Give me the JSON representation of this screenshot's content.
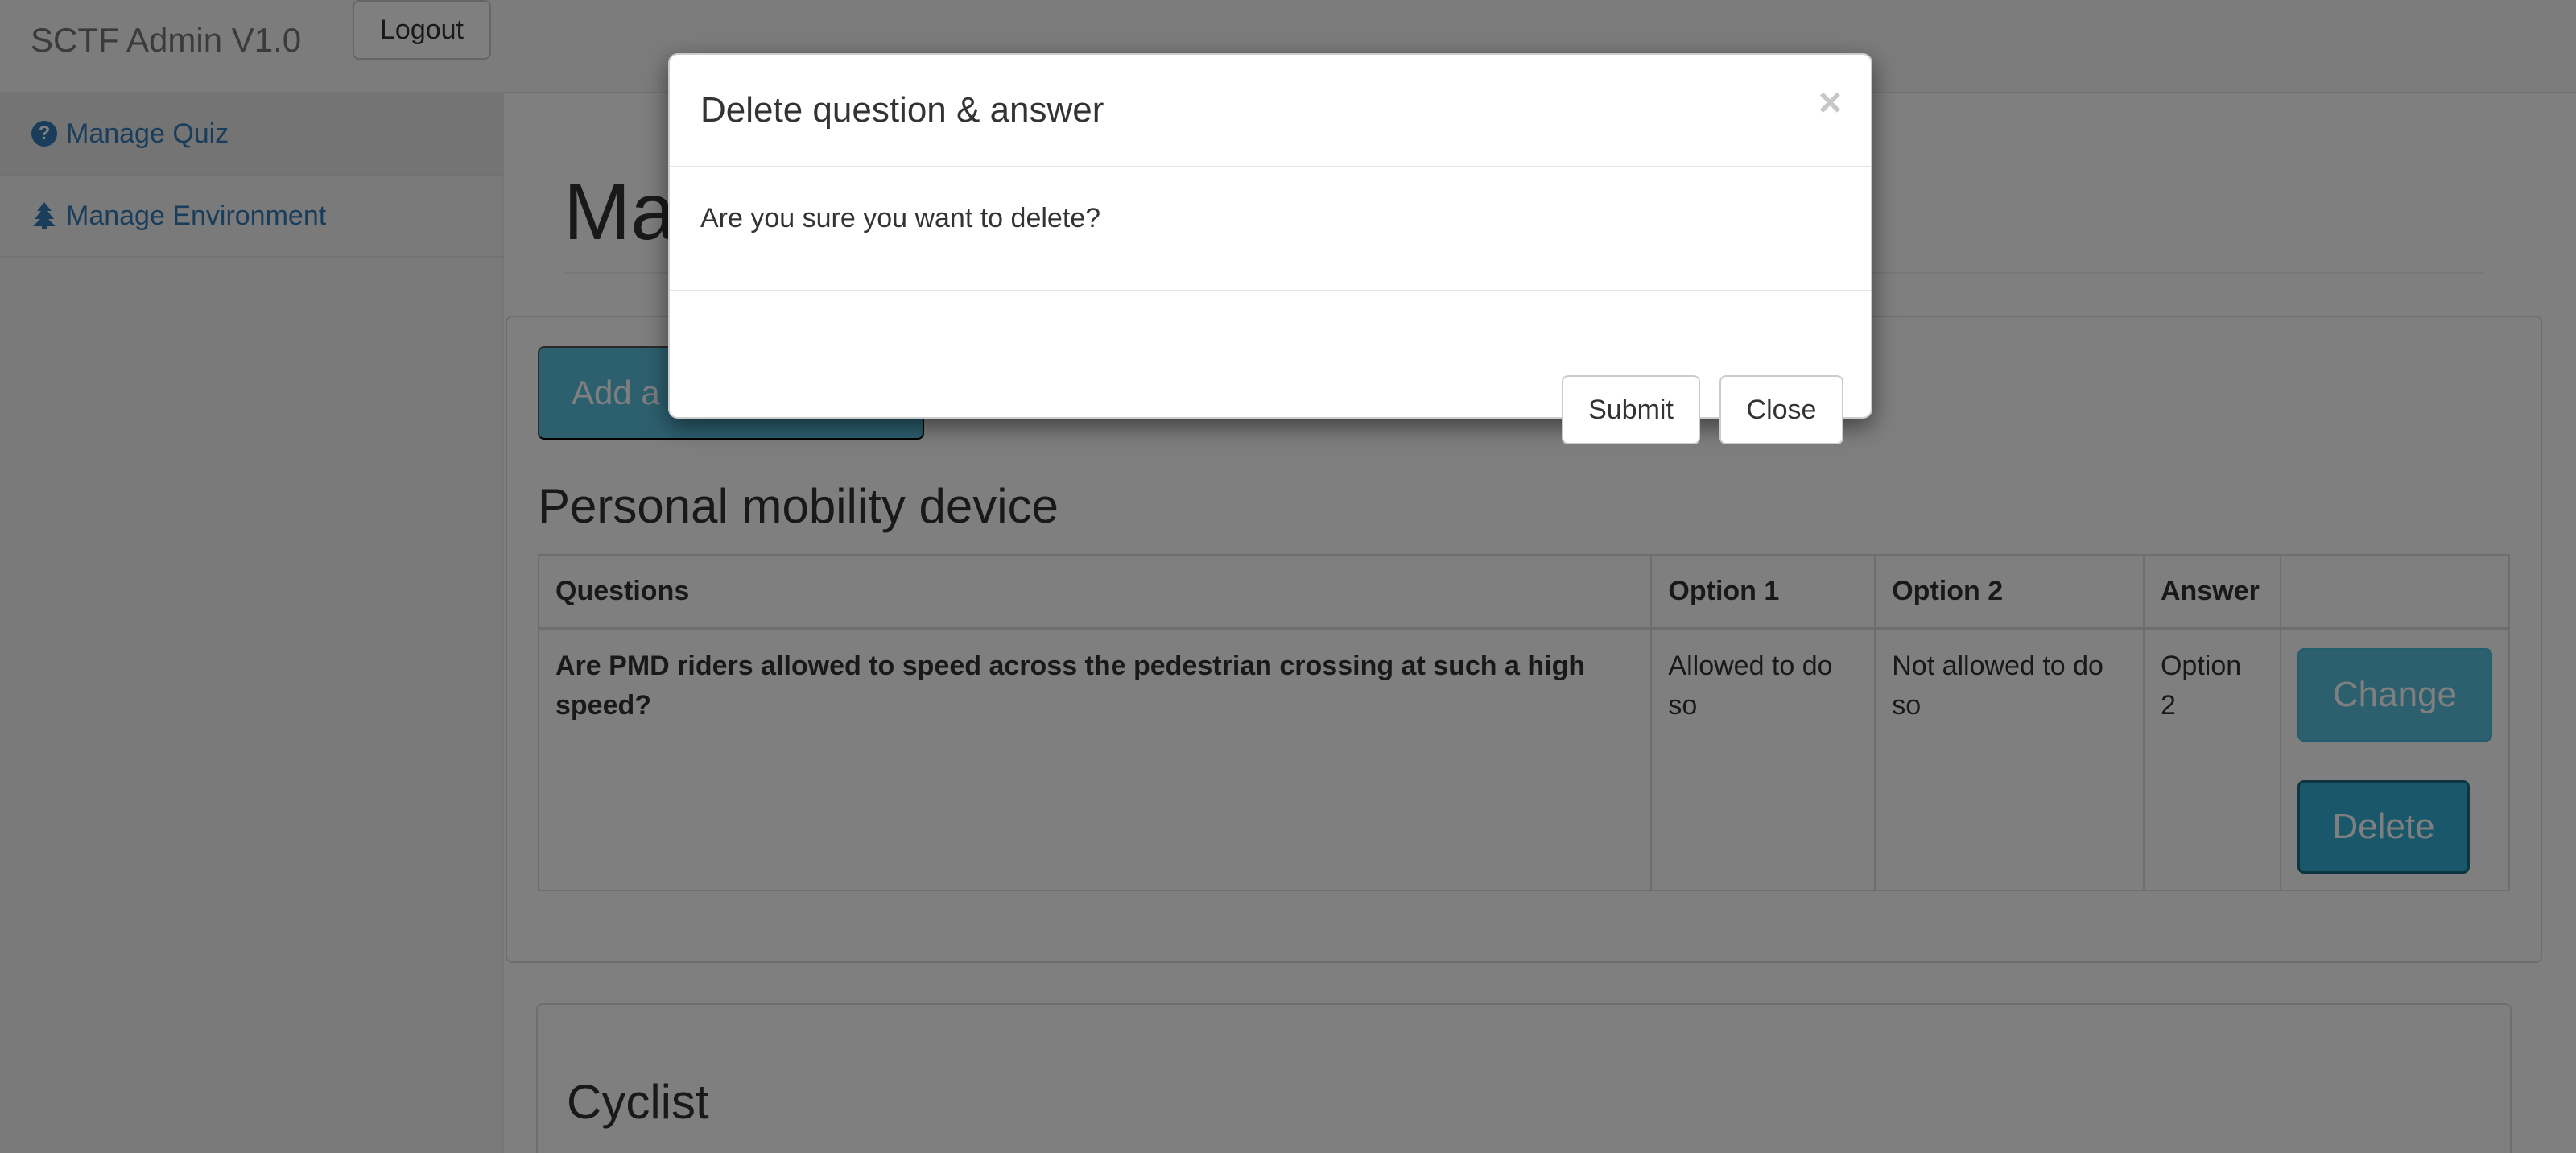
{
  "navbar": {
    "brand": "SCTF Admin V1.0",
    "logout_label": "Logout"
  },
  "sidebar": {
    "items": [
      {
        "icon": "question-circle-icon",
        "label": "Manage Quiz",
        "active": true
      },
      {
        "icon": "tree-icon",
        "label": "Manage Environment",
        "active": false
      }
    ]
  },
  "main": {
    "title": "Ma",
    "add_button_label": "Add a",
    "sections": [
      {
        "title": "Personal mobility device",
        "table": {
          "headers": [
            "Questions",
            "Option 1",
            "Option 2",
            "Answer",
            ""
          ],
          "rows": [
            {
              "question": "Are PMD riders allowed to speed across the pedestrian crossing at such a high speed?",
              "option1": "Allowed to do so",
              "option2": "Not allowed to do so",
              "answer": "Option 2",
              "change_label": "Change",
              "delete_label": "Delete"
            }
          ]
        }
      },
      {
        "title": "Cyclist"
      }
    ]
  },
  "modal": {
    "title": "Delete question & answer",
    "close_symbol": "×",
    "body_text": "Are you sure you want to delete?",
    "submit_label": "Submit",
    "close_label": "Close"
  },
  "colors": {
    "link": "#337ab7",
    "info_button": "#5bc0de",
    "backdrop": "rgba(0,0,0,0.5)"
  }
}
